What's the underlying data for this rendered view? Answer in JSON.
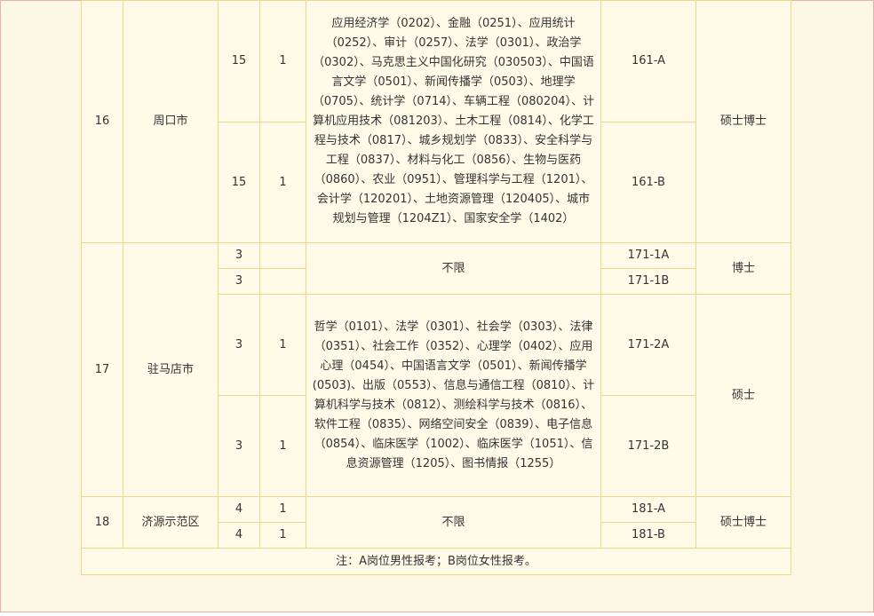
{
  "rows": {
    "r16": {
      "no": "16",
      "city": "周口市",
      "a": {
        "count": "15",
        "ratio": "1",
        "code": "161-A"
      },
      "b": {
        "count": "15",
        "ratio": "1",
        "code": "161-B"
      },
      "majors": "应用经济学（0202）、金融（0251）、应用统计（0252）、审计（0257）、法学（0301）、政治学（0302）、马克思主义中国化研究（030503）、中国语言文学（0501）、新闻传播学（0503）、地理学（0705）、统计学（0714）、车辆工程（080204）、计算机应用技术（081203）、土木工程（0814）、化学工程与技术（0817）、城乡规划学（0833）、安全科学与工程（0837）、材料与化工（0856）、生物与医药（0860）、农业（0951）、管理科学与工程（1201）、会计学（120201）、土地资源管理（120405）、城市规划与管理（1204Z1）、国家安全学（1402）",
      "degree": "硕士博士"
    },
    "r17": {
      "no": "17",
      "city": "驻马店市",
      "a1": {
        "count": "3",
        "ratio": "",
        "code": "171-1A"
      },
      "b1": {
        "count": "3",
        "ratio": "",
        "code": "171-1B"
      },
      "unrestricted": "不限",
      "degree1": "博士",
      "a2": {
        "count": "3",
        "ratio": "1",
        "code": "171-2A"
      },
      "b2": {
        "count": "3",
        "ratio": "1",
        "code": "171-2B"
      },
      "majors2": "哲学（0101）、法学（0301）、社会学（0303）、法律（0351）、社会工作（0352）、心理学（0402）、应用心理（0454）、中国语言文学（0501）、新闻传播学(0503)、出版（0553）、信息与通信工程（0810）、计算机科学与技术（0812）、测绘科学与技术（0816）、软件工程（0835）、网络空间安全（0839）、电子信息（0854）、临床医学（1002）、临床医学（1051）、信息资源管理（1205）、图书情报（1255）",
      "degree2": "硕士"
    },
    "r18": {
      "no": "18",
      "city": "济源示范区",
      "a": {
        "count": "4",
        "ratio": "1",
        "code": "181-A"
      },
      "b": {
        "count": "4",
        "ratio": "1",
        "code": "181-B"
      },
      "majors": "不限",
      "degree": "硕士博士"
    }
  },
  "note": "注：A岗位男性报考；B岗位女性报考。",
  "colors": {
    "border": "#f0d78a",
    "cell_bg": "#fffbe8",
    "page_bg": "#fdf7e6",
    "frame": "#e8b4a8"
  }
}
